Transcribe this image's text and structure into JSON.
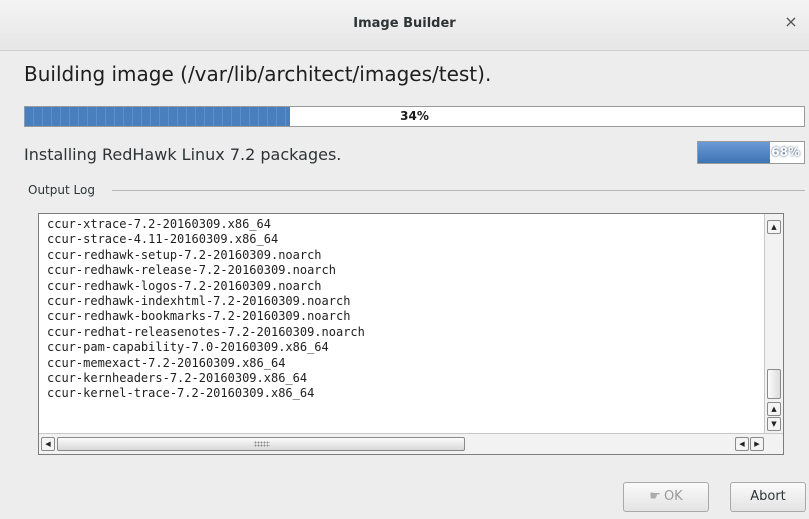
{
  "window": {
    "title": "Image Builder",
    "close_glyph": "×"
  },
  "heading": "Building image (/var/lib/architect/images/test).",
  "overall_progress": {
    "value": 34,
    "label": "34%"
  },
  "status_text": "Installing RedHawk Linux 7.2 packages.",
  "package_progress": {
    "value": 68,
    "label": "68%"
  },
  "output_log": {
    "label": "Output Log",
    "lines": [
      "ccur-xtrace-7.2-20160309.x86_64",
      "ccur-strace-4.11-20160309.x86_64",
      "ccur-redhawk-setup-7.2-20160309.noarch",
      "ccur-redhawk-release-7.2-20160309.noarch",
      "ccur-redhawk-logos-7.2-20160309.noarch",
      "ccur-redhawk-indexhtml-7.2-20160309.noarch",
      "ccur-redhawk-bookmarks-7.2-20160309.noarch",
      "ccur-redhat-releasenotes-7.2-20160309.noarch",
      "ccur-pam-capability-7.0-20160309.x86_64",
      "ccur-memexact-7.2-20160309.x86_64",
      "ccur-kernheaders-7.2-20160309.x86_64",
      "ccur-kernel-trace-7.2-20160309.x86_64"
    ]
  },
  "buttons": {
    "ok": "OK",
    "abort": "Abort"
  },
  "icons": {
    "close": "close-icon",
    "ok": "ok-hand-icon",
    "scroll_up": "scroll-up-arrow-icon",
    "scroll_down": "scroll-down-arrow-icon",
    "scroll_left": "scroll-left-arrow-icon",
    "scroll_right": "scroll-right-arrow-icon"
  },
  "colors": {
    "progress_fill": "#4a7fbd",
    "background": "#ededed"
  }
}
